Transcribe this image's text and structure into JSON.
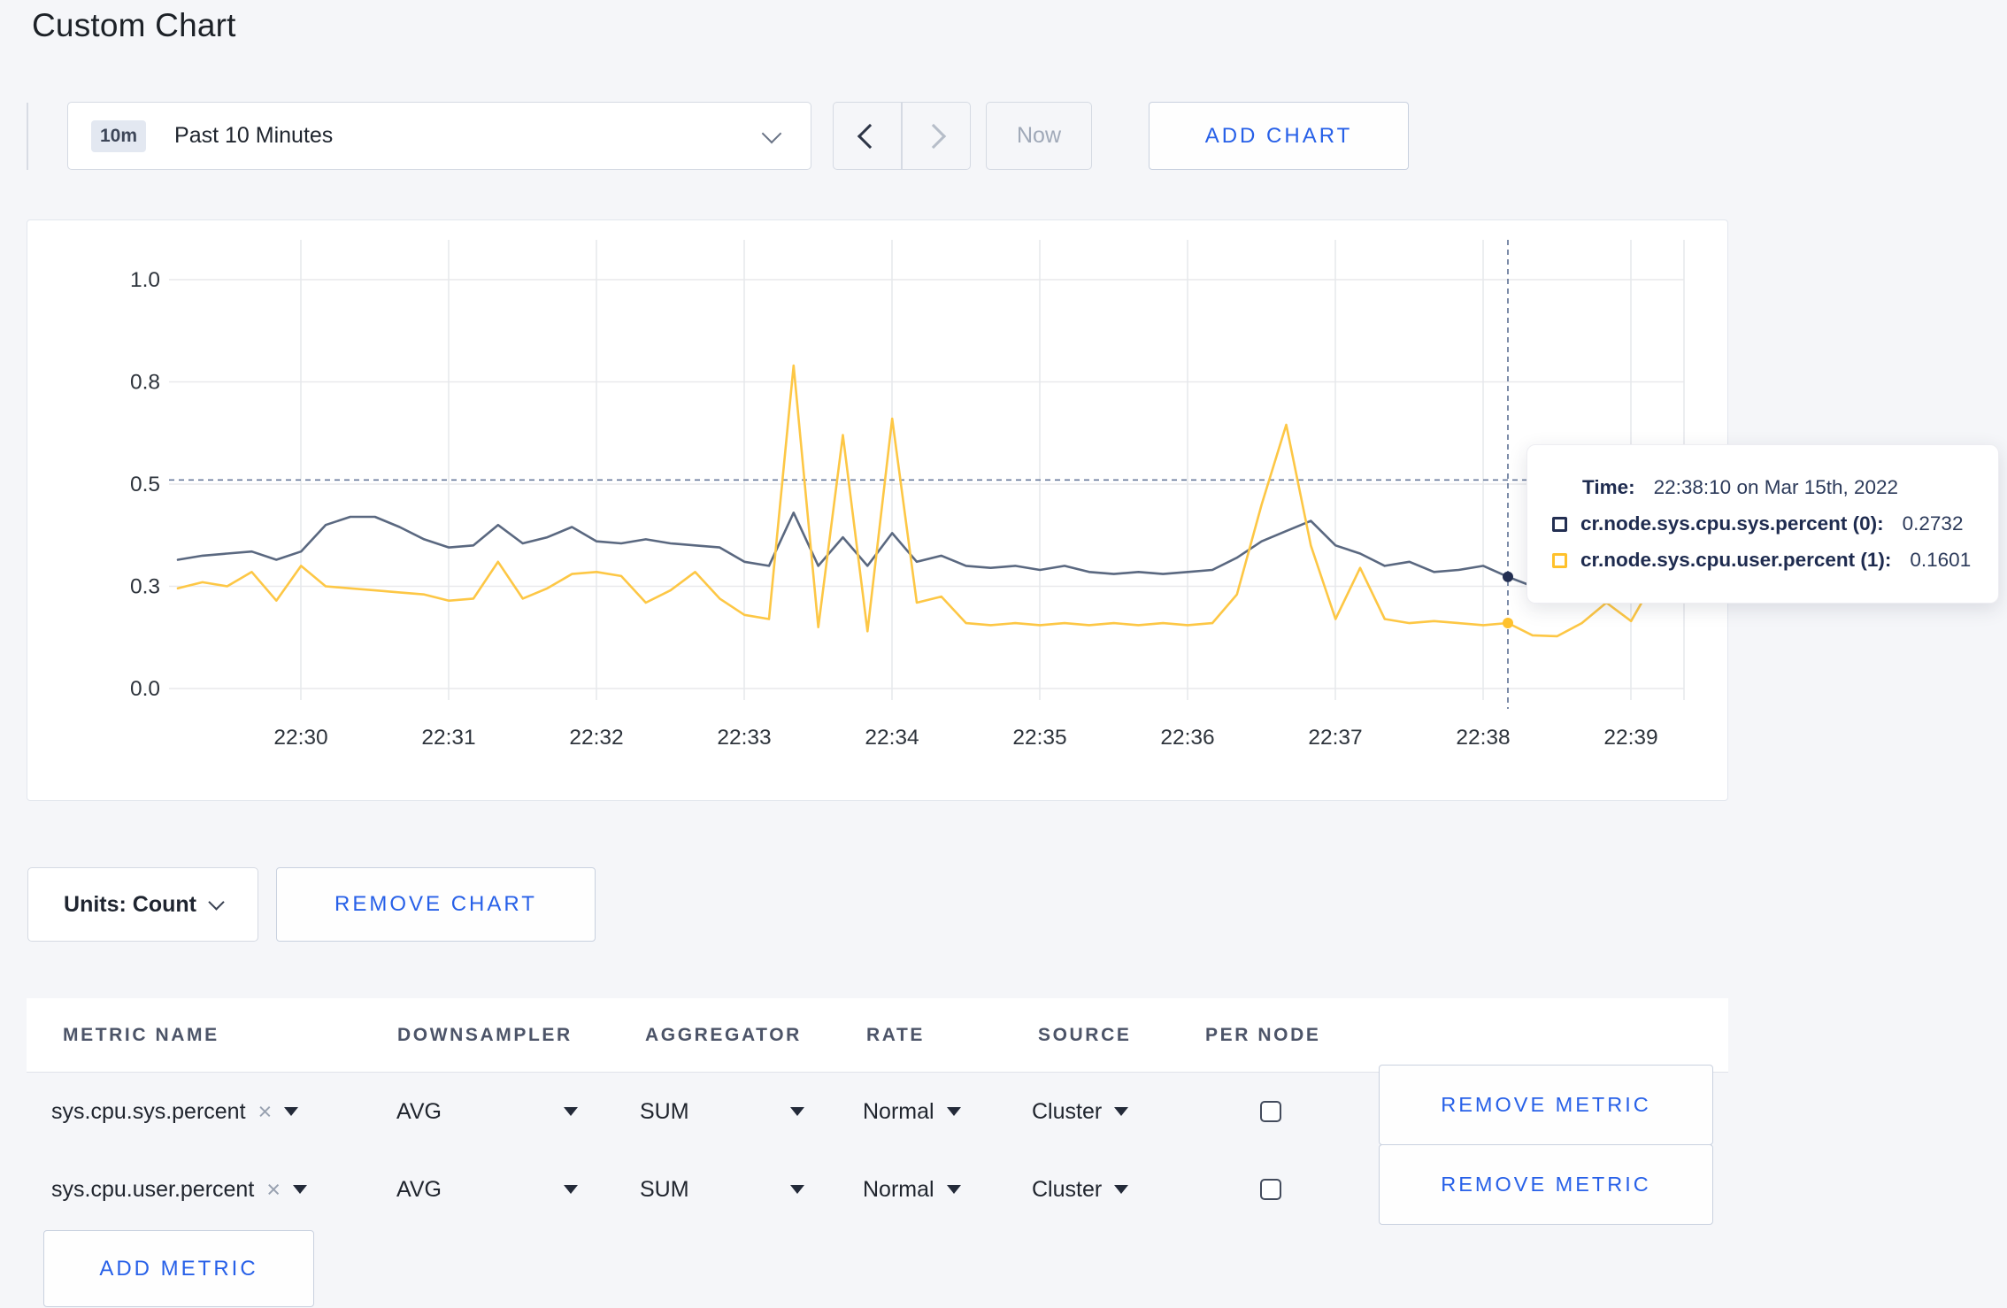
{
  "page": {
    "title": "Custom Chart",
    "accent_color": "#2760e8"
  },
  "toolbar": {
    "range_badge": "10m",
    "range_label": "Past 10 Minutes",
    "now_label": "Now",
    "add_chart_label": "ADD CHART"
  },
  "chart_data": {
    "type": "line",
    "title": "",
    "x_start": "22:29:10",
    "x_step_seconds": 10,
    "x_tick_labels": [
      "22:30",
      "22:31",
      "22:32",
      "22:33",
      "22:34",
      "22:35",
      "22:36",
      "22:37",
      "22:38",
      "22:39"
    ],
    "y_ticks": [
      {
        "label": "0.0",
        "value": 0
      },
      {
        "label": "0.3",
        "value": 0.25
      },
      {
        "label": "0.5",
        "value": 0.5
      },
      {
        "label": "0.8",
        "value": 0.75
      },
      {
        "label": "1.0",
        "value": 1
      }
    ],
    "ylim": [
      0,
      1
    ],
    "grid": true,
    "legend_position": "none",
    "series": [
      {
        "name": "cr.node.sys.cpu.sys.percent (0)",
        "color": "#5a6880",
        "swatch_color": "#232f52",
        "values": [
          0.315,
          0.325,
          0.33,
          0.335,
          0.315,
          0.335,
          0.4,
          0.42,
          0.42,
          0.395,
          0.365,
          0.345,
          0.35,
          0.4,
          0.355,
          0.37,
          0.395,
          0.36,
          0.355,
          0.365,
          0.355,
          0.35,
          0.345,
          0.31,
          0.3,
          0.43,
          0.3,
          0.37,
          0.3,
          0.38,
          0.31,
          0.325,
          0.3,
          0.295,
          0.3,
          0.29,
          0.3,
          0.285,
          0.28,
          0.285,
          0.28,
          0.285,
          0.29,
          0.32,
          0.36,
          0.385,
          0.41,
          0.35,
          0.33,
          0.3,
          0.31,
          0.285,
          0.29,
          0.3,
          0.2732,
          0.25,
          0.27,
          0.315,
          0.285,
          0.265,
          0.3,
          0.28
        ]
      },
      {
        "name": "cr.node.sys.cpu.user.percent (1)",
        "color": "#fdc745",
        "swatch_color": "#ffc12c",
        "values": [
          0.245,
          0.26,
          0.25,
          0.285,
          0.215,
          0.3,
          0.25,
          0.245,
          0.24,
          0.235,
          0.23,
          0.215,
          0.22,
          0.31,
          0.22,
          0.245,
          0.28,
          0.285,
          0.275,
          0.21,
          0.24,
          0.285,
          0.22,
          0.18,
          0.17,
          0.79,
          0.15,
          0.62,
          0.14,
          0.66,
          0.21,
          0.225,
          0.16,
          0.155,
          0.16,
          0.155,
          0.16,
          0.155,
          0.16,
          0.155,
          0.16,
          0.155,
          0.16,
          0.23,
          0.45,
          0.645,
          0.35,
          0.17,
          0.295,
          0.17,
          0.16,
          0.165,
          0.16,
          0.155,
          0.1601,
          0.13,
          0.128,
          0.16,
          0.21,
          0.165,
          0.27,
          0.24
        ]
      }
    ],
    "crosshair": {
      "x_index": 54,
      "time": "22:38:10",
      "h_value": 0.51
    }
  },
  "tooltip": {
    "time_label": "Time:",
    "time_value": "22:38:10 on Mar 15th, 2022",
    "rows": [
      {
        "label": "cr.node.sys.cpu.sys.percent (0):",
        "value": "0.2732"
      },
      {
        "label": "cr.node.sys.cpu.user.percent (1):",
        "value": "0.1601"
      }
    ]
  },
  "units_bar": {
    "units_label": "Units: Count",
    "remove_chart_label": "REMOVE CHART"
  },
  "metrics_table": {
    "headers": [
      "METRIC NAME",
      "DOWNSAMPLER",
      "AGGREGATOR",
      "RATE",
      "SOURCE",
      "PER NODE"
    ],
    "clear_icon": "×",
    "rows": [
      {
        "metric": "sys.cpu.sys.percent",
        "downsampler": "AVG",
        "aggregator": "SUM",
        "rate": "Normal",
        "source": "Cluster",
        "per_node_checked": false,
        "remove_label": "REMOVE METRIC"
      },
      {
        "metric": "sys.cpu.user.percent",
        "downsampler": "AVG",
        "aggregator": "SUM",
        "rate": "Normal",
        "source": "Cluster",
        "per_node_checked": false,
        "remove_label": "REMOVE METRIC"
      }
    ],
    "add_metric_label": "ADD METRIC"
  }
}
